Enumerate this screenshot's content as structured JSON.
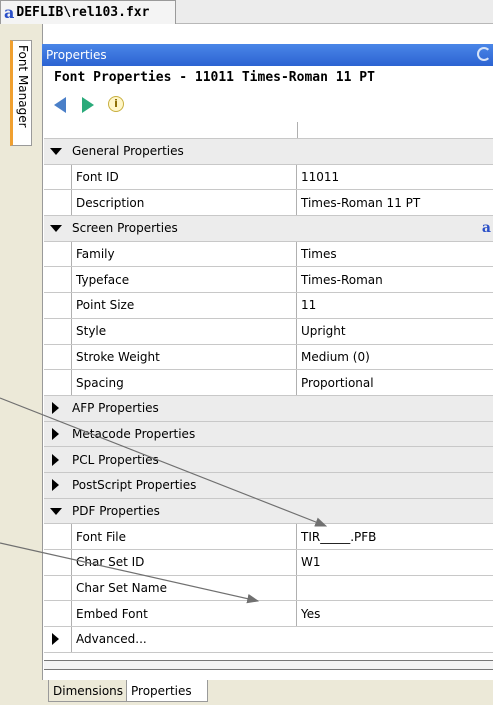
{
  "document_tab": {
    "logo": "a",
    "title": "DEFLIB\\rel103.fxr"
  },
  "left_tab": {
    "label": "Font Manager"
  },
  "panel": {
    "header": "Properties",
    "font_title": "Font Properties - 11011  Times-Roman 11 PT"
  },
  "nav": {
    "back_icon": "back-arrow-icon",
    "forward_icon": "forward-arrow-icon",
    "info_icon": "info-icon",
    "info_glyph": "i"
  },
  "general": {
    "label": "General Properties",
    "font_id_label": "Font ID",
    "font_id": "11011",
    "description_label": "Description",
    "description": "Times-Roman 11 PT"
  },
  "screen": {
    "label": "Screen Properties",
    "icon_text": "a",
    "family_label": "Family",
    "family": "Times",
    "typeface_label": "Typeface",
    "typeface": "Times-Roman",
    "point_size_label": "Point Size",
    "point_size": "11",
    "style_label": "Style",
    "style": "Upright",
    "stroke_weight_label": "Stroke Weight",
    "stroke_weight": "Medium (0)",
    "spacing_label": "Spacing",
    "spacing": "Proportional"
  },
  "categories": {
    "afp": "AFP Properties",
    "metacode": "Metacode Properties",
    "pcl": "PCL Properties",
    "postscript": "PostScript Properties"
  },
  "pdf": {
    "label": "PDF Properties",
    "font_file_label": "Font File",
    "font_file": "TIR_____.PFB",
    "char_set_id_label": "Char Set ID",
    "char_set_id": "W1",
    "char_set_name_label": "Char Set Name",
    "char_set_name": "",
    "embed_font_label": "Embed Font",
    "embed_font": "Yes"
  },
  "advanced": {
    "label": "Advanced..."
  },
  "bottom_tabs": {
    "dimensions": "Dimensions",
    "properties": "Properties"
  },
  "colors": {
    "header_blue": "#3a74dc",
    "accent_orange": "#f0a030",
    "category_gray": "#ececec"
  }
}
